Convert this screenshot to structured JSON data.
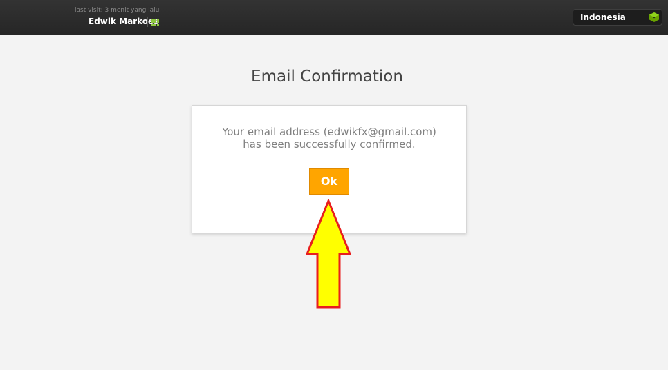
{
  "header": {
    "last_visit": "last visit: 3 menit yang lalu",
    "user_name": "Edwik Markoes",
    "apps_icon": "grid-icon",
    "language": {
      "selected": "Indonesia",
      "icon": "cube-icon",
      "icon_color": "#7ab800"
    }
  },
  "main": {
    "title": "Email Confirmation",
    "message_line1": "Your email address (edwikfx@gmail.com)",
    "message_line2": "has been successfully confirmed.",
    "ok_label": "Ok",
    "ok_color": "#ffa500"
  },
  "annotation": {
    "icon": "up-arrow-icon",
    "fill_color": "#ffff00",
    "stroke_color": "#e81e1e"
  }
}
